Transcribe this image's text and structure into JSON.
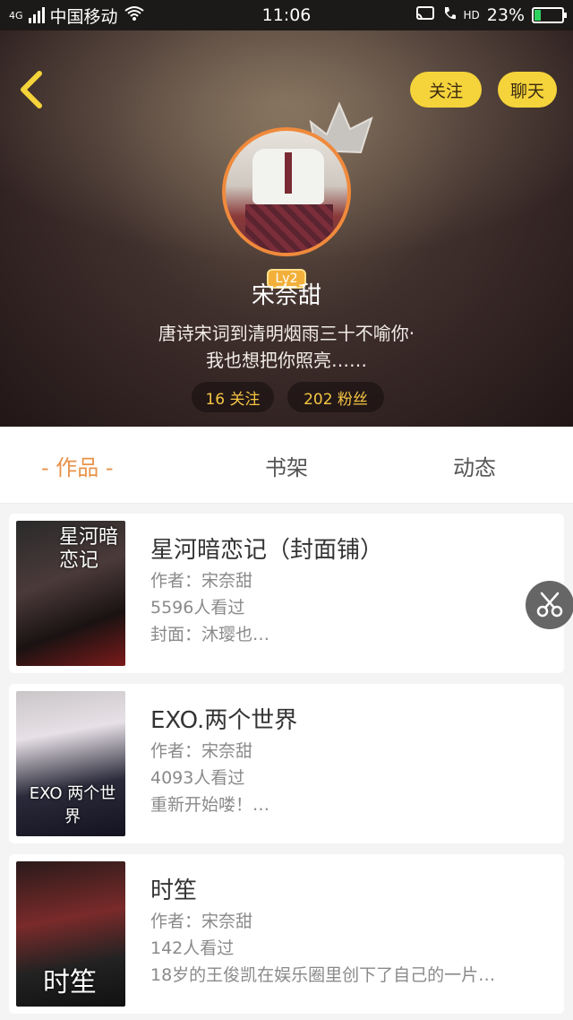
{
  "status_bar": {
    "network": "4G",
    "carrier": "中国移动",
    "time": "11:06",
    "hd": "HD",
    "battery": "23%",
    "battery_level": 0.23
  },
  "header": {
    "follow_button": "关注",
    "chat_button": "聊天",
    "level": "Lv2",
    "username": "宋奈甜",
    "bio_line1": "唐诗宋词到清明烟雨三十不喻你·",
    "bio_line2": "我也想把你照亮……",
    "following": "16 关注",
    "fans": "202 粉丝"
  },
  "tabs": [
    {
      "label": "- 作品 -",
      "active": true
    },
    {
      "label": "书架",
      "active": false
    },
    {
      "label": "动态",
      "active": false
    }
  ],
  "works": [
    {
      "cover_text": "星河暗恋记",
      "title": "星河暗恋记（封面铺）",
      "author": "作者：宋奈甜",
      "views": "5596人看过",
      "desc": "封面：沐璎也…"
    },
    {
      "cover_text": "EXO 两个世界",
      "title": "EXO.两个世界",
      "author": "作者：宋奈甜",
      "views": "4093人看过",
      "desc": "重新开始喽！…"
    },
    {
      "cover_text": "时笙",
      "title": "时笙",
      "author": "作者：宋奈甜",
      "views": "142人看过",
      "desc": "18岁的王俊凯在娱乐圈里创下了自己的一片…"
    }
  ],
  "icons": {
    "back": "chevron-left-icon",
    "crown": "crown-icon",
    "fab": "scissors-icon",
    "wifi": "wifi-icon",
    "cast": "cast-icon",
    "call": "volte-icon"
  },
  "colors": {
    "accent": "#e8924a",
    "yellow_button": "#f5d33a",
    "stat_text": "#f5c543"
  }
}
